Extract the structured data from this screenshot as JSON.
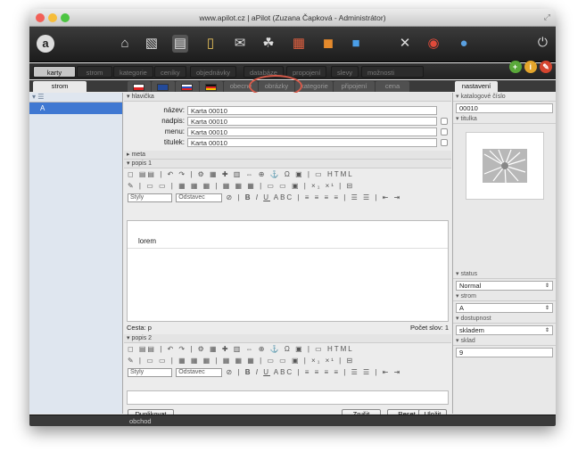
{
  "window": {
    "title": "www.apilot.cz | aPilot (Zuzana Čapková - Administrátor)"
  },
  "toolbar": {
    "icons": [
      "home-icon",
      "document-icon",
      "storage-icon",
      "clipboard-icon",
      "mail-icon",
      "users-icon",
      "calendar-icon",
      "database-icon",
      "folder-icon",
      "tools-icon",
      "lifebuoy-icon",
      "globe-icon",
      "power-icon"
    ]
  },
  "nav": {
    "tabs": [
      "karty",
      "strom",
      "kategorie",
      "ceníky",
      "objednávky",
      "databáze",
      "propojení",
      "slevy",
      "možnosti"
    ],
    "active": "karty"
  },
  "subtabs": {
    "left": "strom",
    "items": [
      "obecné",
      "obrázky",
      "kategorie",
      "připojení",
      "cena"
    ],
    "right": "nastavení"
  },
  "tree": {
    "selected": "A"
  },
  "header": {
    "section": "hlavička",
    "fields": [
      {
        "label": "název:",
        "value": "Karta 00010"
      },
      {
        "label": "nadpis:",
        "value": "Karta 00010"
      },
      {
        "label": "menu:",
        "value": "Karta 00010"
      },
      {
        "label": "titulek:",
        "value": "Karta 00010"
      }
    ]
  },
  "meta": {
    "section": "meta"
  },
  "popis1": {
    "section": "popis 1",
    "styles": "Styly",
    "format": "Odstavec",
    "content": "lorem",
    "path": "Cesta: p",
    "word_count": "Počet slov: 1"
  },
  "popis2": {
    "section": "popis 2",
    "styles": "Styly",
    "format": "Odstavec"
  },
  "buttons": {
    "duplicate": "Duplikovat",
    "cancel": "Zrušit",
    "reset": "Reset",
    "save": "Uložit"
  },
  "right": {
    "catalog_label": "katalogové číslo",
    "catalog_value": "00010",
    "thumb_label": "titulka",
    "status_label": "status",
    "status_value": "Normal",
    "tree_label": "strom",
    "tree_value": "A",
    "availability_label": "dostupnost",
    "availability_value": "skladem",
    "stock_label": "sklad",
    "stock_value": "9"
  },
  "statusbar": {
    "text": "obchod"
  }
}
